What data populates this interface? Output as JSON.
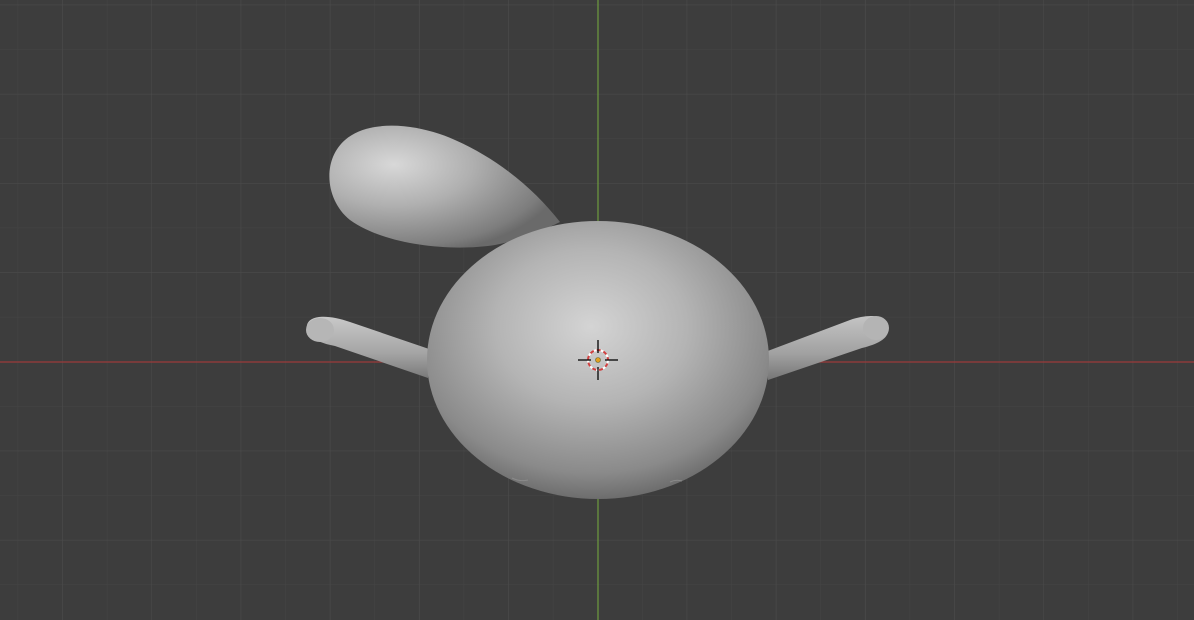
{
  "viewport": {
    "app": "3D viewport",
    "view": "orthographic-front",
    "shading": "solid",
    "colors": {
      "background": "#3d3d3d",
      "grid_minor": "#454545",
      "grid_major": "#4a4a4a",
      "x_axis": "#9b3b3b",
      "z_axis": "#6e9b3e",
      "mesh_light": "#d0d0d0",
      "mesh_mid": "#a5a5a5",
      "mesh_dark": "#6a6a6a"
    },
    "objects": [
      {
        "name": "body-mesh",
        "icon": "sphere"
      },
      {
        "name": "ear-mesh",
        "icon": "teardrop"
      },
      {
        "name": "left-arm-mesh",
        "icon": "capsule"
      },
      {
        "name": "right-arm-mesh",
        "icon": "capsule"
      }
    ],
    "cursor": {
      "icon": "3d-cursor-icon"
    }
  }
}
